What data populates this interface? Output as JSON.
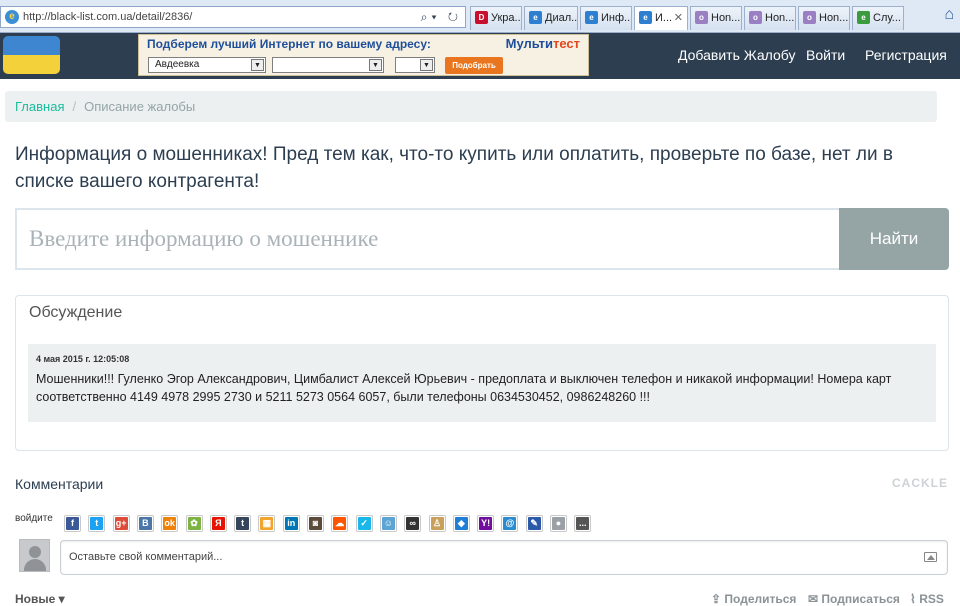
{
  "browser": {
    "url": "http://black-list.com.ua/detail/2836/",
    "tabs": [
      {
        "label": "Укра..."
      },
      {
        "label": "Диал..."
      },
      {
        "label": "Инф..."
      },
      {
        "label": "И...",
        "active": true
      },
      {
        "label": "Hon..."
      },
      {
        "label": "Hon..."
      },
      {
        "label": "Hon..."
      },
      {
        "label": "Слу..."
      }
    ]
  },
  "ad": {
    "title": "Подберем лучший Интернет по вашему адресу:",
    "brand_main": "Мульти",
    "brand_accent": "тест",
    "city_value": "Авдеевка",
    "street_value": "",
    "house_value": "",
    "button_label": "Подобрать"
  },
  "nav": {
    "add_complaint": "Добавить Жалобу",
    "login": "Войти",
    "register": "Регистрация"
  },
  "breadcrumb": {
    "home": "Главная",
    "separator": "/",
    "current": "Описание жалобы"
  },
  "headline": "Информация о мошенниках! Пред тем как, что-то купить или оплатить, проверьте по базе, нет ли в списке вашего контрагента!",
  "search": {
    "placeholder": "Введите информацию о мошеннике",
    "button": "Найти"
  },
  "discussion": {
    "title": "Обсуждение",
    "date": "4 мая 2015 г. 12:05:08",
    "text": "Мошенники!!! Гуленко Эгор Александрович, Цимбалист Алексей Юрьевич - предоплата и выключен телефон и никакой информации! Номера карт соответственно 4149 4978 2995 2730 и 5211 5273 0564 6057, были телефоны 0634530452, 0986248260 !!!"
  },
  "comments": {
    "title": "Комментарии",
    "provider": "CACKLE",
    "login_label": "войдите",
    "social": [
      {
        "name": "facebook-icon",
        "glyph": "f",
        "color": "#3b5998"
      },
      {
        "name": "twitter-icon",
        "glyph": "t",
        "color": "#1da1f2"
      },
      {
        "name": "google-plus-icon",
        "glyph": "g+",
        "color": "#dd4b39"
      },
      {
        "name": "vkontakte-icon",
        "glyph": "B",
        "color": "#4a76a8"
      },
      {
        "name": "odnoklassniki-icon",
        "glyph": "ok",
        "color": "#ee8208"
      },
      {
        "name": "mail-agent-icon",
        "glyph": "✿",
        "color": "#7cb342"
      },
      {
        "name": "yandex-icon",
        "glyph": "Я",
        "color": "#e61400"
      },
      {
        "name": "tumblr-icon",
        "glyph": "t",
        "color": "#35465c"
      },
      {
        "name": "windows-live-icon",
        "glyph": "▦",
        "color": "#f3a42c"
      },
      {
        "name": "linkedin-icon",
        "glyph": "in",
        "color": "#0077b5"
      },
      {
        "name": "instagram-icon",
        "glyph": "◙",
        "color": "#5b4b3a"
      },
      {
        "name": "soundcloud-icon",
        "glyph": "☁",
        "color": "#ff5500"
      },
      {
        "name": "vimeo-icon",
        "glyph": "✓",
        "color": "#1ab7ea"
      },
      {
        "name": "yahoo-messenger-icon",
        "glyph": "☺",
        "color": "#5ba4d6"
      },
      {
        "name": "flickr-icon",
        "glyph": "∞",
        "color": "#333333"
      },
      {
        "name": "lastfm-icon",
        "glyph": "♙",
        "color": "#c9a15a"
      },
      {
        "name": "dropbox-icon",
        "glyph": "◆",
        "color": "#1f7fd6"
      },
      {
        "name": "yahoo-icon",
        "glyph": "Y!",
        "color": "#720e9e"
      },
      {
        "name": "email-icon",
        "glyph": "@",
        "color": "#2a8bd1"
      },
      {
        "name": "openid-icon",
        "glyph": "✎",
        "color": "#2b5aa8"
      },
      {
        "name": "anonymous-icon",
        "glyph": "●",
        "color": "#9aa0a5"
      },
      {
        "name": "more-icon",
        "glyph": "...",
        "color": "#555555"
      }
    ],
    "input_placeholder": "Оставьте свой комментарий...",
    "sort_label": "Новые",
    "share": "Поделиться",
    "subscribe": "Подписаться",
    "rss": "RSS"
  }
}
